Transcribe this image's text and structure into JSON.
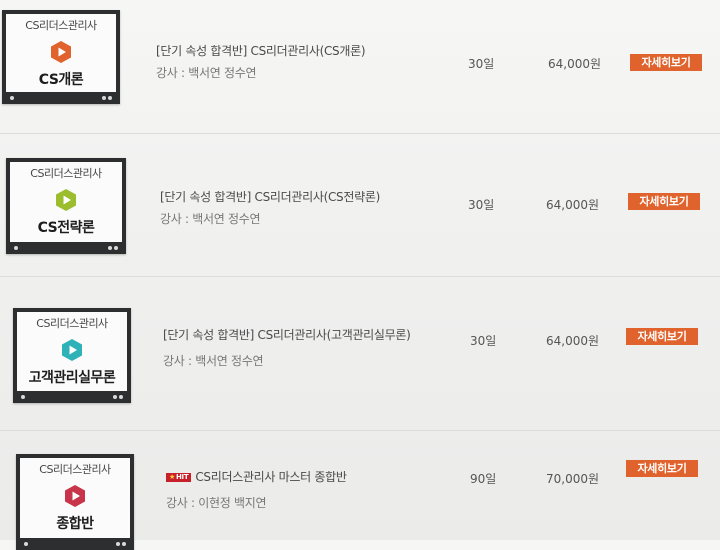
{
  "courses": [
    {
      "thumb_title": "CS리더스관리사",
      "thumb_subject": "CS개론",
      "play_color": "#e0622c",
      "title": "[단기 속성 합격반] CS리더관리사(CS개론)",
      "instructor": "강사 : 백서연 정수연",
      "days": "30일",
      "price": "64,000원",
      "button_label": "자세히보기",
      "hit": false
    },
    {
      "thumb_title": "CS리더스관리사",
      "thumb_subject": "CS전략론",
      "play_color": "#9cbd2e",
      "title": "[단기 속성 합격반] CS리더관리사(CS전략론)",
      "instructor": "강사 : 백서연 정수연",
      "days": "30일",
      "price": "64,000원",
      "button_label": "자세히보기",
      "hit": false
    },
    {
      "thumb_title": "CS리더스관리사",
      "thumb_subject": "고객관리실무론",
      "play_color": "#2fb1b8",
      "title": "[단기 속성 합격반] CS리더관리사(고객관리실무론)",
      "instructor": "강사 : 백서연 정수연",
      "days": "30일",
      "price": "64,000원",
      "button_label": "자세히보기",
      "hit": false
    },
    {
      "thumb_title": "CS리더스관리사",
      "thumb_subject": "종합반",
      "play_color": "#c8344a",
      "title": "CS리더스관리사 마스터 종합반",
      "instructor": "강사 : 이현정 백지연",
      "days": "90일",
      "price": "70,000원",
      "button_label": "자세히보기",
      "hit": true,
      "hit_label": "HIT"
    }
  ]
}
